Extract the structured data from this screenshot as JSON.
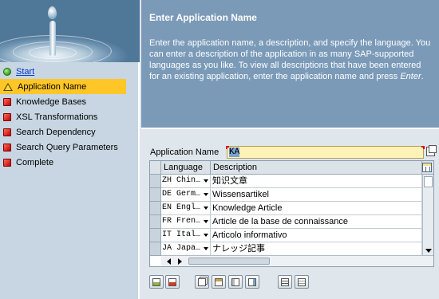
{
  "nav": {
    "items": [
      {
        "label": "Start",
        "icon": "green-circle-icon",
        "state": "link"
      },
      {
        "label": "Application Name",
        "icon": "yellow-triangle-icon",
        "state": "selected"
      },
      {
        "label": "Knowledge Bases",
        "icon": "red-square-icon",
        "state": "normal"
      },
      {
        "label": "XSL Transformations",
        "icon": "red-square-icon",
        "state": "normal"
      },
      {
        "label": "Search Dependency",
        "icon": "red-square-icon",
        "state": "normal"
      },
      {
        "label": "Search Query Parameters",
        "icon": "red-square-icon",
        "state": "normal"
      },
      {
        "label": "Complete",
        "icon": "red-square-icon",
        "state": "normal"
      }
    ]
  },
  "info": {
    "title": "Enter Application Name",
    "text": "Enter the application name, a description, and specify the language. You can enter a description of the application in as many SAP-supported languages as you like. To view all descriptions that have been entered for an existing application, enter the application name and press ",
    "text_em": "Enter",
    "text_end": "."
  },
  "form": {
    "app_name_label": "Application Name",
    "app_name_value": "KA"
  },
  "table": {
    "columns": [
      "Language",
      "Description"
    ],
    "rows": [
      {
        "language": "ZH Chin…",
        "description": "知识文章"
      },
      {
        "language": "DE Germ…",
        "description": "Wissensartikel"
      },
      {
        "language": "EN Engl…",
        "description": "Knowledge Article"
      },
      {
        "language": "FR Fren…",
        "description": "Article de la base de connaissance"
      },
      {
        "language": "IT Ital…",
        "description": "Articolo informativo"
      },
      {
        "language": "JA Japa…",
        "description": "ナレッジ記事"
      }
    ]
  },
  "toolbar": {
    "buttons": [
      "insert-row-icon",
      "delete-row-icon",
      "copy-icon",
      "paste-icon",
      "cut-icon",
      "undo-icon",
      "select-all-icon",
      "deselect-all-icon"
    ]
  },
  "colors": {
    "info_bg": "#7a9ab8",
    "nav_bg": "#c7d6e2",
    "selected_bg": "#ffc627",
    "input_bg": "#fdf2b8"
  }
}
